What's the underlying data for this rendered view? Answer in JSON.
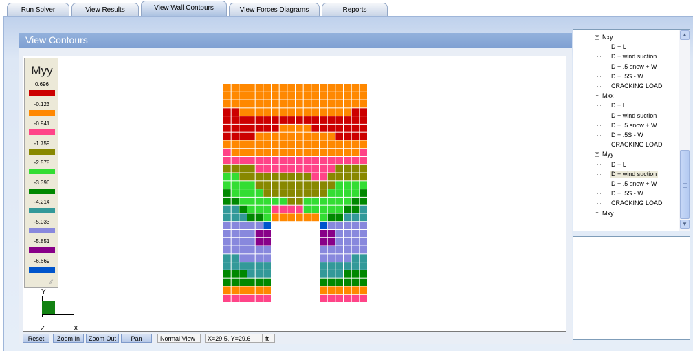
{
  "tabs": [
    {
      "label": "Run Solver",
      "active": false
    },
    {
      "label": "View Results",
      "active": false
    },
    {
      "label": "View Wall Contours",
      "active": true
    },
    {
      "label": "View Forces Diagrams",
      "active": false
    },
    {
      "label": "Reports",
      "active": false
    }
  ],
  "view": {
    "title": "View Contours"
  },
  "legend": {
    "title": "Myy",
    "items": [
      {
        "value": "0.696",
        "color": "#cc0000"
      },
      {
        "value": "-0.123",
        "color": "#ff8800"
      },
      {
        "value": "-0.941",
        "color": "#ff4488"
      },
      {
        "value": "-1.759",
        "color": "#888800"
      },
      {
        "value": "-2.578",
        "color": "#33dd33"
      },
      {
        "value": "-3.396",
        "color": "#008800"
      },
      {
        "value": "-4.214",
        "color": "#339999"
      },
      {
        "value": "-5.033",
        "color": "#8888dd"
      },
      {
        "value": "-5.851",
        "color": "#880088"
      },
      {
        "value": "-6.669",
        "color": "#0055cc"
      }
    ]
  },
  "contour": {
    "columns": 18,
    "rows": 27,
    "legend": "0:#cc0000 1:#ff8800 2:#ff4488 3:#888800 4:#33dd33 5:#008800 6:#339999 7:#8888dd 8:#880088 9:#0055cc",
    "grid": [
      "111111111111111111",
      "111111111111111111",
      "111111111111111111",
      "001111111111111100",
      "000000000000000000",
      "000000011110000000",
      "000011111111110000",
      "111111111111111111",
      "211111111111111112",
      "222222222222222222",
      "333322222222223333",
      "443333333332233333",
      "444433333333334444",
      "544443333333344445",
      "554444443344444455",
      "665444222244444556",
      "666554111111455666",
      "777779......977777",
      "777788......887777",
      "777788......887777",
      "777777......777777",
      "667777......777766",
      "666666......666666",
      "555666......666555",
      "555555......555555",
      "111111......111111",
      "222222......222222"
    ]
  },
  "axes": {
    "y": "Y",
    "x": "X",
    "z": "Z"
  },
  "toolbar": {
    "reset": "Reset",
    "zoom_in": "Zoom In",
    "zoom_out": "Zoom Out",
    "pan": "Pan",
    "view_mode": "Normal View",
    "coords": "X=29.5, Y=29.6",
    "unit": "ft"
  },
  "tree": {
    "groups": [
      {
        "label": "Nxy",
        "expanded": true,
        "items": [
          "D + L",
          "D + wind suction",
          "D + .5 snow + W",
          "D + .5S - W",
          "CRACKING  LOAD"
        ]
      },
      {
        "label": "Mxx",
        "expanded": true,
        "items": [
          "D + L",
          "D + wind suction",
          "D + .5 snow + W",
          "D + .5S - W",
          "CRACKING  LOAD"
        ]
      },
      {
        "label": "Myy",
        "expanded": true,
        "items": [
          "D + L",
          "D + wind suction",
          "D + .5 snow + W",
          "D + .5S - W",
          "CRACKING  LOAD"
        ]
      },
      {
        "label": "Mxy",
        "expanded": false,
        "items": []
      }
    ],
    "selected": "Myy / D + wind suction"
  }
}
